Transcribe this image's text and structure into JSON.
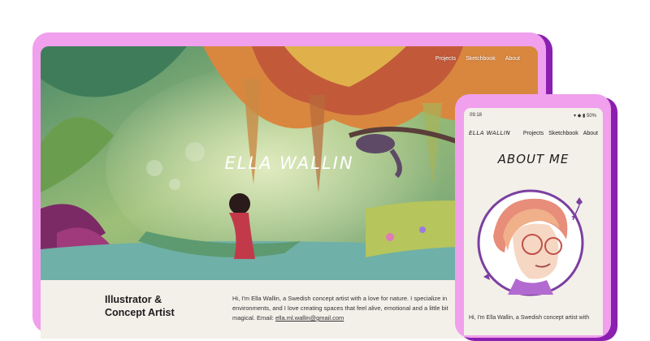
{
  "desktop": {
    "nav": [
      "Projects",
      "Sketchbook",
      "About"
    ],
    "hero_title": "ELLA WALLIN",
    "role_line1": "Illustrator &",
    "role_line2": "Concept Artist",
    "bio": "Hi, I'm Ella Wallin, a Swedish concept artist with a love for nature. I specialize in environments, and I love creating spaces that feel alive, emotional and a little bit magical. Email: ",
    "email": "ella.ml.wallin@gmail.com"
  },
  "phone": {
    "status_time": "09:18",
    "status_battery": "50%",
    "logo": "ELLA WALLIN",
    "nav": [
      "Projects",
      "Sketchbook",
      "About"
    ],
    "title": "ABOUT ME",
    "bio": "Hi, I'm Ella Wallin, a Swedish concept artist with"
  },
  "colors": {
    "frame_pink": "#f0a0ec",
    "frame_shadow": "#8a1fb0",
    "page_bg": "#f3efe9"
  }
}
